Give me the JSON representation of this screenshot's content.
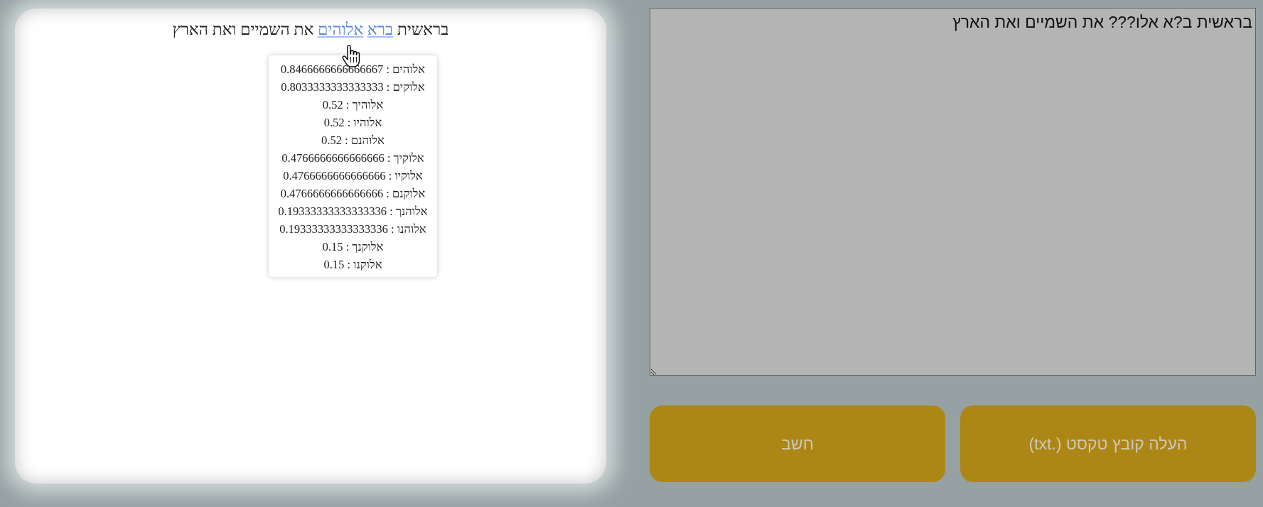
{
  "result": {
    "words": [
      {
        "text": "בראשית",
        "linked": false
      },
      {
        "text": "ברא",
        "linked": true
      },
      {
        "text": "אלוהים",
        "linked": true
      },
      {
        "text": "את",
        "linked": false
      },
      {
        "text": "השמיים",
        "linked": false
      },
      {
        "text": "ואת",
        "linked": false
      },
      {
        "text": "הארץ",
        "linked": false
      }
    ]
  },
  "suggestions": [
    "אלוהים : 0.8466666666666667",
    "אלוקים : 0.8033333333333333",
    "אלוהיך : 0.52",
    "אלוהיו : 0.52",
    "אלוהנם : 0.52",
    "אלוקיך : 0.4766666666666666",
    "אלוקיו : 0.4766666666666666",
    "אלוקנם : 0.4766666666666666",
    "אלוהנך : 0.19333333333333336",
    "אלוהנו : 0.19333333333333336",
    "אלוקנך : 0.15",
    "אלוקנו : 0.15"
  ],
  "input": {
    "value": "בראשית ב?א אלו??? את השמיים ואת הארץ"
  },
  "buttons": {
    "calculate": "חשב",
    "upload": "העלה קובץ טקסט (.txt)"
  }
}
